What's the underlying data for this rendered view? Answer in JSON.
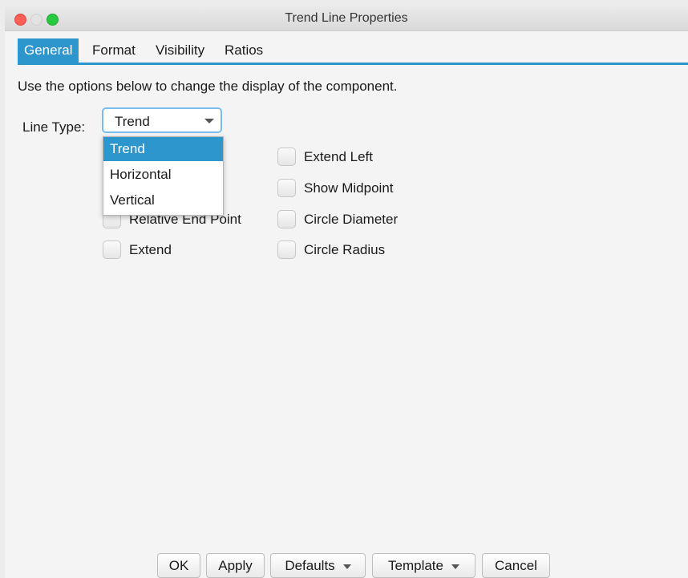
{
  "window": {
    "title": "Trend Line Properties"
  },
  "tabs": [
    {
      "label": "General",
      "active": true
    },
    {
      "label": "Format",
      "active": false
    },
    {
      "label": "Visibility",
      "active": false
    },
    {
      "label": "Ratios",
      "active": false
    }
  ],
  "description": "Use the options below to change the display of the component.",
  "line_type": {
    "label": "Line Type:",
    "value": "Trend",
    "options": [
      "Trend",
      "Horizontal",
      "Vertical"
    ],
    "selected_index": 0
  },
  "checkboxes": {
    "left": [
      {
        "label": "Relative End Point",
        "checked": false
      },
      {
        "label": "Extend",
        "checked": false
      }
    ],
    "right": [
      {
        "label": "Extend Left",
        "checked": false
      },
      {
        "label": "Show Midpoint",
        "checked": false
      },
      {
        "label": "Circle Diameter",
        "checked": false
      },
      {
        "label": "Circle Radius",
        "checked": false
      }
    ]
  },
  "buttons": {
    "ok": "OK",
    "apply": "Apply",
    "defaults": "Defaults",
    "template": "Template",
    "cancel": "Cancel"
  },
  "colors": {
    "accent": "#2d96cd",
    "close": "#ff5f57",
    "maximize": "#28c940"
  }
}
